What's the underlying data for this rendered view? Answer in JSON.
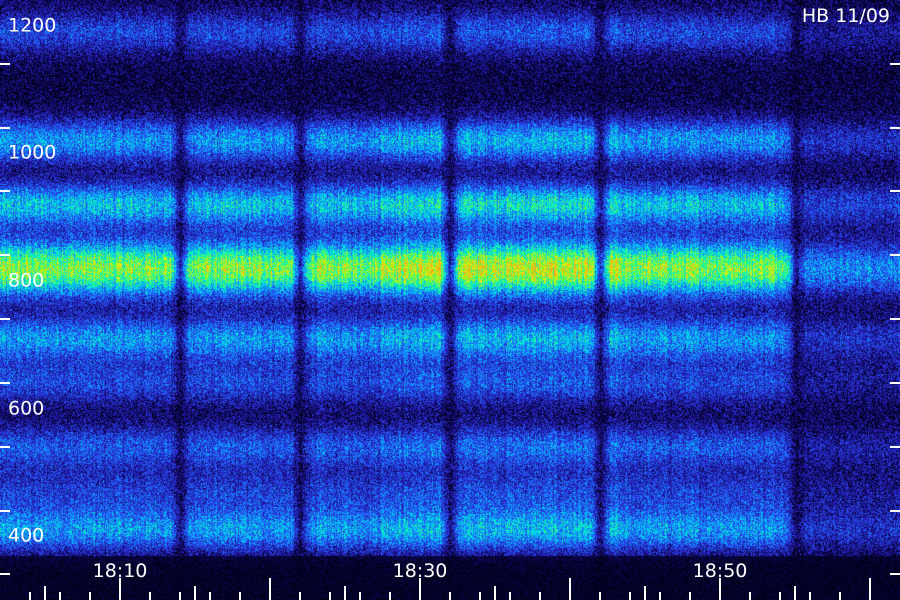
{
  "header_label": "HB 11/09",
  "chart_data": {
    "type": "heatmap",
    "title": "",
    "xlabel": "",
    "ylabel": "",
    "y_ticks": [
      "1200",
      "1000",
      "800",
      "600",
      "400"
    ],
    "x_ticks": [
      "18:10",
      "18:30",
      "18:50"
    ],
    "ylim": [
      300,
      1240
    ],
    "xlim": [
      "18:02",
      "19:02"
    ],
    "colormap": [
      "#000018",
      "#1a0d8a",
      "#2d2dd6",
      "#1e6bff",
      "#00c8ff",
      "#00ffb0",
      "#7dff2a",
      "#ffe800",
      "#ff9a1a"
    ],
    "bands_y": [
      {
        "center": 1190,
        "intensity": 0.35
      },
      {
        "center": 1020,
        "intensity": 0.55
      },
      {
        "center": 920,
        "intensity": 0.65
      },
      {
        "center": 820,
        "intensity": 1.0
      },
      {
        "center": 710,
        "intensity": 0.55
      },
      {
        "center": 640,
        "intensity": 0.35
      },
      {
        "center": 540,
        "intensity": 0.4
      },
      {
        "center": 470,
        "intensity": 0.3
      },
      {
        "center": 410,
        "intensity": 0.55
      }
    ],
    "gaps_x": [
      "18:14",
      "18:22",
      "18:32",
      "18:42",
      "18:55"
    ]
  }
}
